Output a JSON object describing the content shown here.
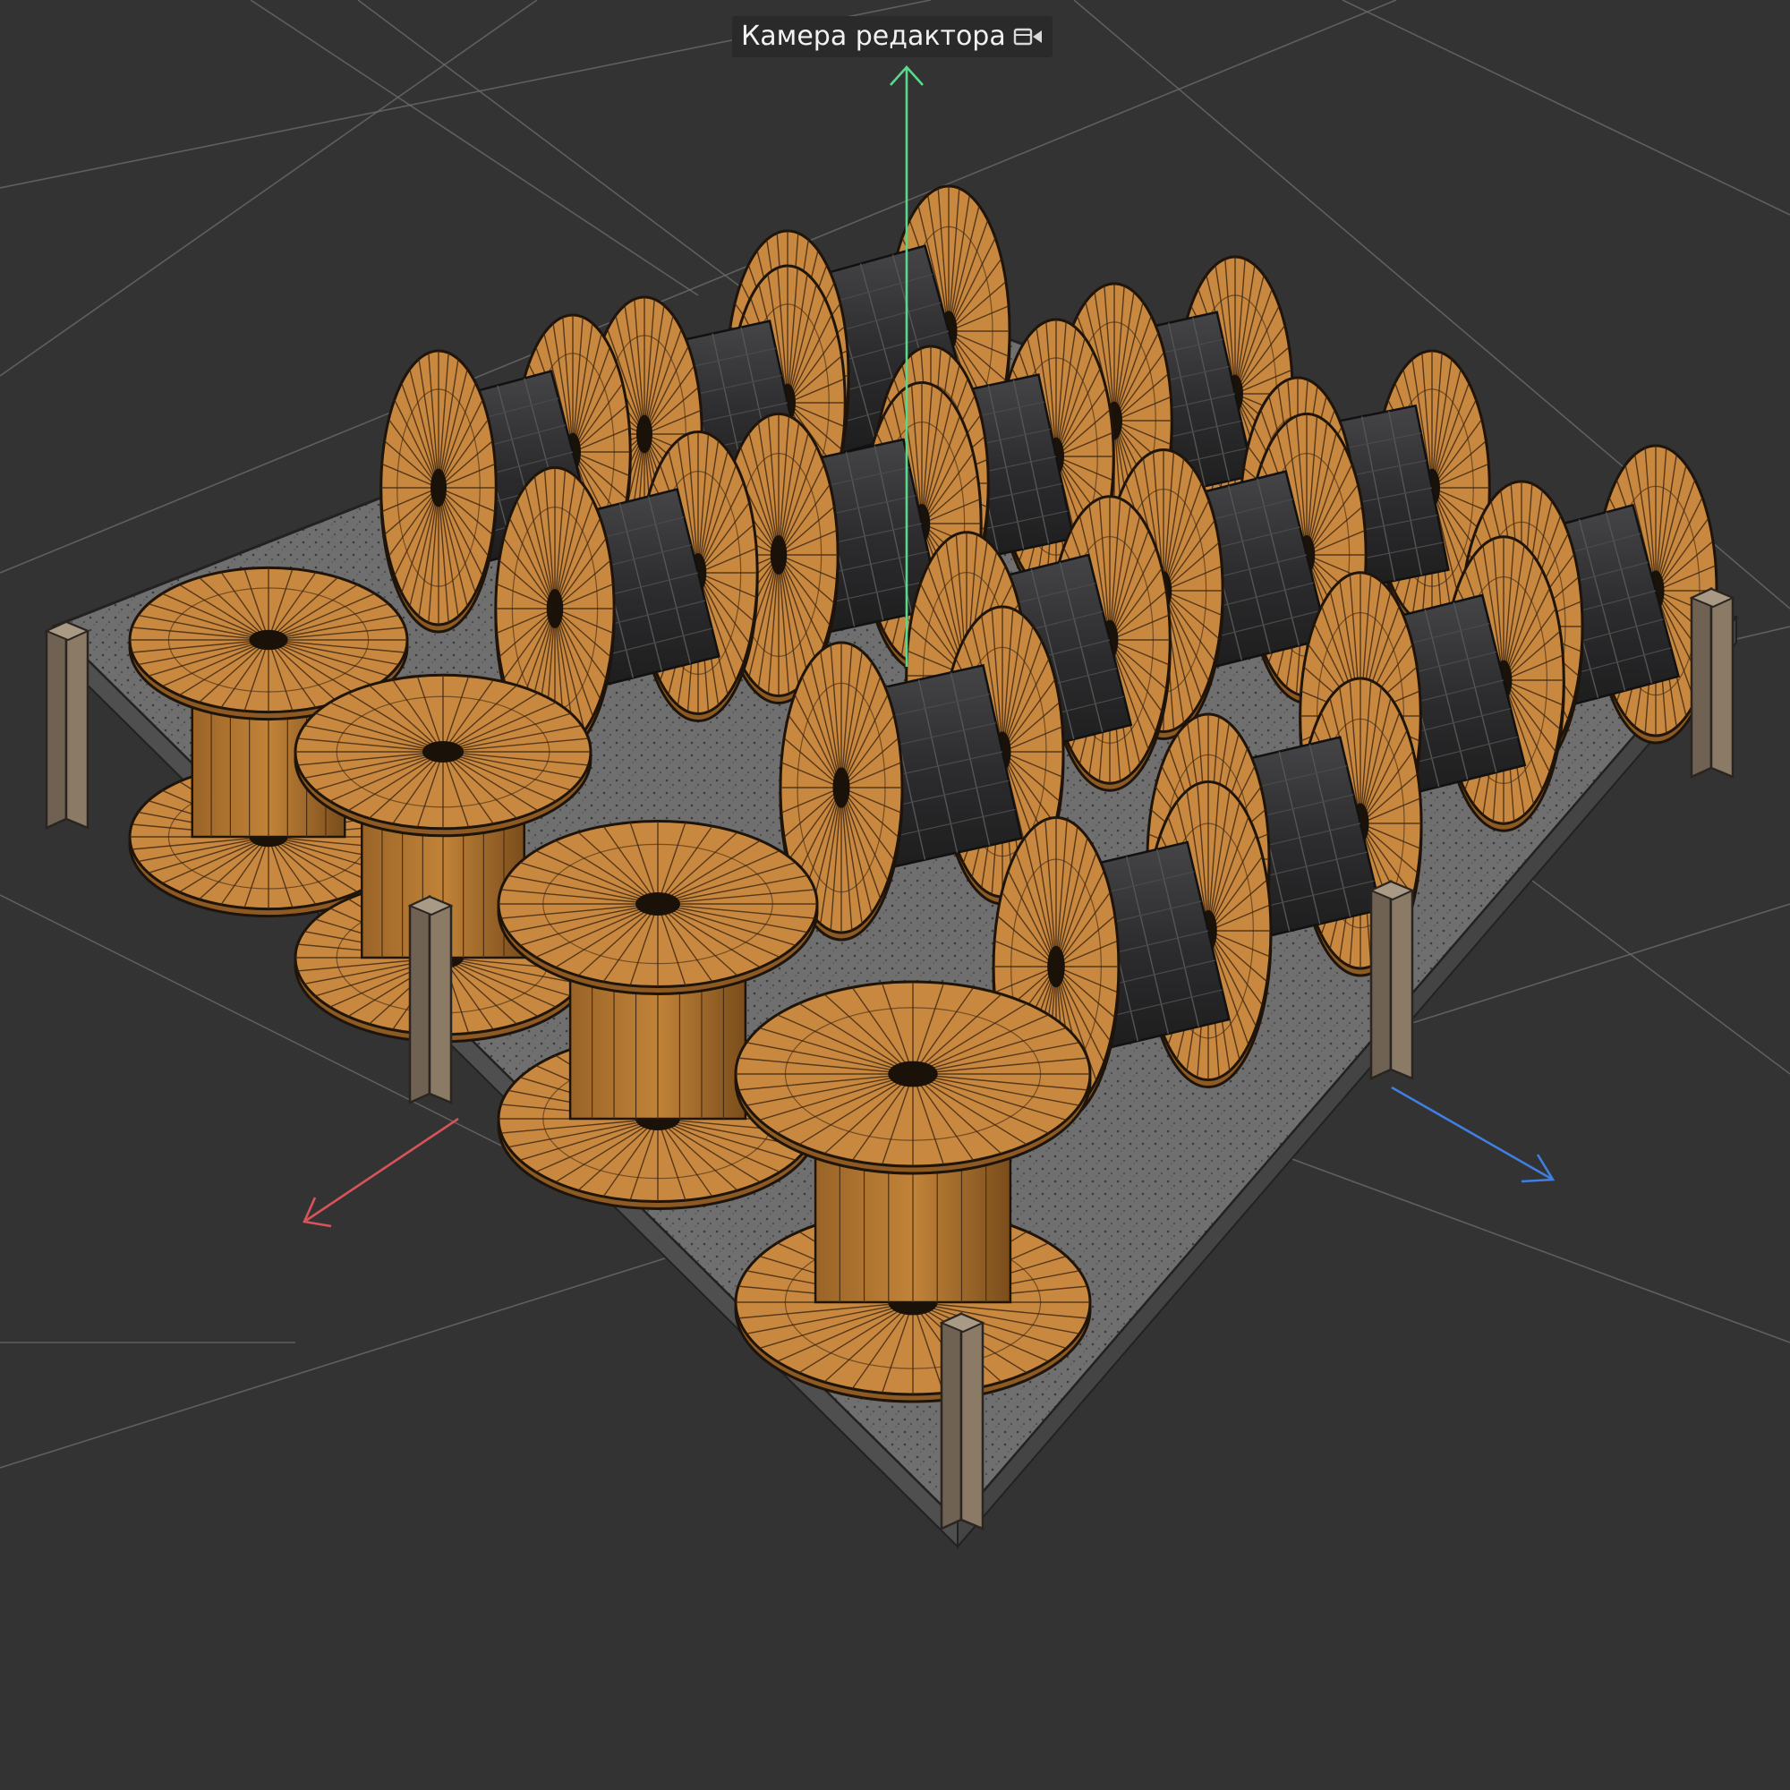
{
  "viewport": {
    "camera_label": "Камера редактора",
    "camera_icon": "camera-icon",
    "background_color": "#333333",
    "grid_color": "#6e6e6e"
  },
  "gizmo": {
    "axes": [
      {
        "name": "x",
        "color": "#d9535a"
      },
      {
        "name": "y",
        "color": "#58d98c"
      },
      {
        "name": "z",
        "color": "#3f7fe0"
      }
    ]
  },
  "scene": {
    "object": "cable-spool-pallet",
    "rows": 4,
    "cols": 4,
    "spool_wood_color": "#c8883f",
    "spool_wood_dark": "#8c5a22",
    "cable_color": "#2b2b2d",
    "pallet_color": "#7d7d7d",
    "post_color": "#8a7a66",
    "wireframe": true
  }
}
